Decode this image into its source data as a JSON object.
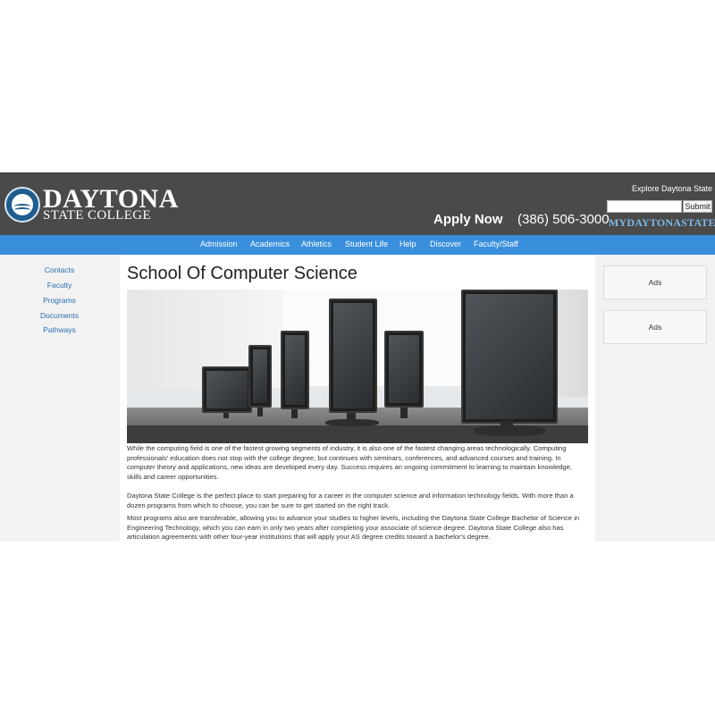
{
  "header": {
    "logo_line1": "DAYTONA",
    "logo_line2": "STATE COLLEGE",
    "apply_now": "Apply Now",
    "phone": "(386) 506-3000",
    "explore": "Explore Daytona State",
    "search": {
      "placeholder": "",
      "submit_label": "Submit"
    },
    "portal": "MYDAYTONASTATE"
  },
  "nav": {
    "items": [
      {
        "label": "Admission"
      },
      {
        "label": "Academics"
      },
      {
        "label": "Athletics"
      },
      {
        "label": "Student Life"
      },
      {
        "label": "Help"
      },
      {
        "label": "Discover"
      },
      {
        "label": "Faculty/Staff"
      }
    ]
  },
  "left_sidebar": {
    "links": [
      {
        "label": "Contacts"
      },
      {
        "label": "Faculty"
      },
      {
        "label": "Programs"
      },
      {
        "label": "Documents"
      },
      {
        "label": "Pathways"
      }
    ]
  },
  "main": {
    "title": "School Of Computer Science",
    "paragraphs": [
      "While the computing field is one of the fastest growing segments of industry, it is also one of the fastest changing areas technologically. Computing professionals' education does not stop with the college degree, but continues with seminars, conferences, and advanced courses and training. In computer theory and applications, new ideas are developed every day. Success requires an ongoing commitment to learning to maintain knowledge, skills and career opportunities.",
      "Daytona State College is the perfect place to start preparing for a career in the computer science and information technology fields. With more than a dozen programs from which to choose, you can be sure to get started on the right track.",
      "Most programs also are transferable, allowing you to advance your studies to higher levels, including the Daytona State College Bachelor of Science in Engineering Technology, which you can earn in only two years after completing your associate of science degree. Daytona State College also has articulation agreements with other four-year institutions that will apply your AS degree credits toward a bachelor's degree."
    ]
  },
  "right_sidebar": {
    "ads": [
      {
        "label": "Ads"
      },
      {
        "label": "Ads"
      }
    ]
  },
  "colors": {
    "header_bg": "#4a4a4a",
    "nav_bg": "#3a8fdd",
    "link": "#2a6fb0",
    "portal_text": "#7fb8e6"
  }
}
